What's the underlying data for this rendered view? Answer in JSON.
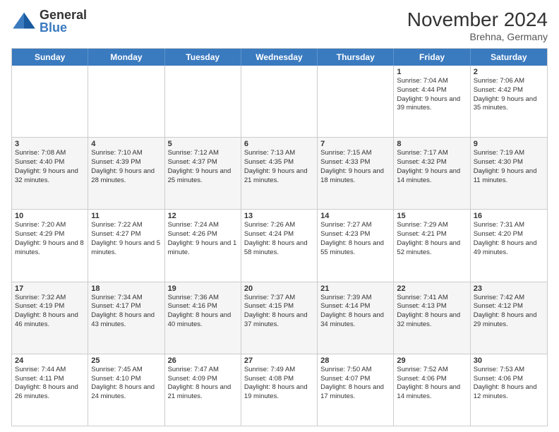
{
  "logo": {
    "line1": "General",
    "line2": "Blue"
  },
  "title": "November 2024",
  "location": "Brehna, Germany",
  "header_days": [
    "Sunday",
    "Monday",
    "Tuesday",
    "Wednesday",
    "Thursday",
    "Friday",
    "Saturday"
  ],
  "rows": [
    {
      "alt": false,
      "cells": [
        {
          "empty": true
        },
        {
          "empty": true
        },
        {
          "empty": true
        },
        {
          "empty": true
        },
        {
          "empty": true
        },
        {
          "day": "1",
          "sunrise": "7:04 AM",
          "sunset": "4:44 PM",
          "daylight": "9 hours and 39 minutes."
        },
        {
          "day": "2",
          "sunrise": "7:06 AM",
          "sunset": "4:42 PM",
          "daylight": "9 hours and 35 minutes."
        }
      ]
    },
    {
      "alt": true,
      "cells": [
        {
          "day": "3",
          "sunrise": "7:08 AM",
          "sunset": "4:40 PM",
          "daylight": "9 hours and 32 minutes."
        },
        {
          "day": "4",
          "sunrise": "7:10 AM",
          "sunset": "4:39 PM",
          "daylight": "9 hours and 28 minutes."
        },
        {
          "day": "5",
          "sunrise": "7:12 AM",
          "sunset": "4:37 PM",
          "daylight": "9 hours and 25 minutes."
        },
        {
          "day": "6",
          "sunrise": "7:13 AM",
          "sunset": "4:35 PM",
          "daylight": "9 hours and 21 minutes."
        },
        {
          "day": "7",
          "sunrise": "7:15 AM",
          "sunset": "4:33 PM",
          "daylight": "9 hours and 18 minutes."
        },
        {
          "day": "8",
          "sunrise": "7:17 AM",
          "sunset": "4:32 PM",
          "daylight": "9 hours and 14 minutes."
        },
        {
          "day": "9",
          "sunrise": "7:19 AM",
          "sunset": "4:30 PM",
          "daylight": "9 hours and 11 minutes."
        }
      ]
    },
    {
      "alt": false,
      "cells": [
        {
          "day": "10",
          "sunrise": "7:20 AM",
          "sunset": "4:29 PM",
          "daylight": "9 hours and 8 minutes."
        },
        {
          "day": "11",
          "sunrise": "7:22 AM",
          "sunset": "4:27 PM",
          "daylight": "9 hours and 5 minutes."
        },
        {
          "day": "12",
          "sunrise": "7:24 AM",
          "sunset": "4:26 PM",
          "daylight": "9 hours and 1 minute."
        },
        {
          "day": "13",
          "sunrise": "7:26 AM",
          "sunset": "4:24 PM",
          "daylight": "8 hours and 58 minutes."
        },
        {
          "day": "14",
          "sunrise": "7:27 AM",
          "sunset": "4:23 PM",
          "daylight": "8 hours and 55 minutes."
        },
        {
          "day": "15",
          "sunrise": "7:29 AM",
          "sunset": "4:21 PM",
          "daylight": "8 hours and 52 minutes."
        },
        {
          "day": "16",
          "sunrise": "7:31 AM",
          "sunset": "4:20 PM",
          "daylight": "8 hours and 49 minutes."
        }
      ]
    },
    {
      "alt": true,
      "cells": [
        {
          "day": "17",
          "sunrise": "7:32 AM",
          "sunset": "4:19 PM",
          "daylight": "8 hours and 46 minutes."
        },
        {
          "day": "18",
          "sunrise": "7:34 AM",
          "sunset": "4:17 PM",
          "daylight": "8 hours and 43 minutes."
        },
        {
          "day": "19",
          "sunrise": "7:36 AM",
          "sunset": "4:16 PM",
          "daylight": "8 hours and 40 minutes."
        },
        {
          "day": "20",
          "sunrise": "7:37 AM",
          "sunset": "4:15 PM",
          "daylight": "8 hours and 37 minutes."
        },
        {
          "day": "21",
          "sunrise": "7:39 AM",
          "sunset": "4:14 PM",
          "daylight": "8 hours and 34 minutes."
        },
        {
          "day": "22",
          "sunrise": "7:41 AM",
          "sunset": "4:13 PM",
          "daylight": "8 hours and 32 minutes."
        },
        {
          "day": "23",
          "sunrise": "7:42 AM",
          "sunset": "4:12 PM",
          "daylight": "8 hours and 29 minutes."
        }
      ]
    },
    {
      "alt": false,
      "cells": [
        {
          "day": "24",
          "sunrise": "7:44 AM",
          "sunset": "4:11 PM",
          "daylight": "8 hours and 26 minutes."
        },
        {
          "day": "25",
          "sunrise": "7:45 AM",
          "sunset": "4:10 PM",
          "daylight": "8 hours and 24 minutes."
        },
        {
          "day": "26",
          "sunrise": "7:47 AM",
          "sunset": "4:09 PM",
          "daylight": "8 hours and 21 minutes."
        },
        {
          "day": "27",
          "sunrise": "7:49 AM",
          "sunset": "4:08 PM",
          "daylight": "8 hours and 19 minutes."
        },
        {
          "day": "28",
          "sunrise": "7:50 AM",
          "sunset": "4:07 PM",
          "daylight": "8 hours and 17 minutes."
        },
        {
          "day": "29",
          "sunrise": "7:52 AM",
          "sunset": "4:06 PM",
          "daylight": "8 hours and 14 minutes."
        },
        {
          "day": "30",
          "sunrise": "7:53 AM",
          "sunset": "4:06 PM",
          "daylight": "8 hours and 12 minutes."
        }
      ]
    }
  ]
}
